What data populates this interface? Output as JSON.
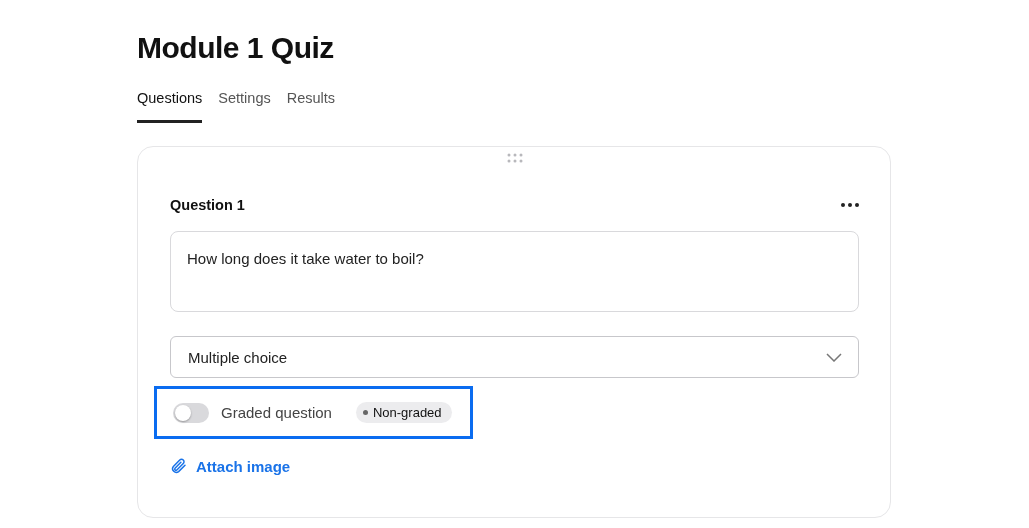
{
  "title": "Module 1 Quiz",
  "tabs": [
    {
      "label": "Questions",
      "selected": true
    },
    {
      "label": "Settings",
      "selected": false
    },
    {
      "label": "Results",
      "selected": false
    }
  ],
  "question": {
    "heading": "Question 1",
    "text": "How long does it take water to boil?",
    "type": "Multiple choice",
    "graded": {
      "label": "Graded question",
      "on": false,
      "badge": "Non-graded",
      "highlighted": true
    },
    "attach": "Attach image"
  }
}
